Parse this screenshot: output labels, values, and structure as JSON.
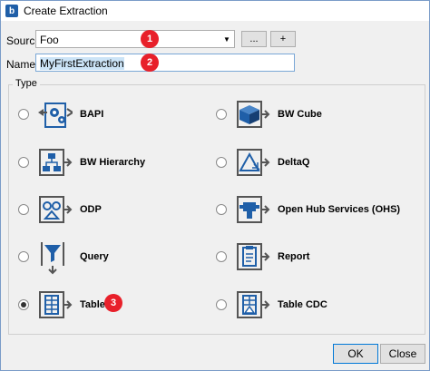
{
  "window": {
    "title": "Create Extraction",
    "app_icon": "b"
  },
  "form": {
    "source_label": "Source",
    "source_value": "Foo",
    "browse_label": "...",
    "add_label": "+",
    "name_label": "Name",
    "name_value": "MyFirstExtraction"
  },
  "badges": [
    "1",
    "2",
    "3"
  ],
  "type_group": {
    "title": "Type",
    "options": [
      {
        "label": "BAPI",
        "icon": "bapi-gears-icon",
        "checked": false
      },
      {
        "label": "BW Cube",
        "icon": "bw-cube-icon",
        "checked": false
      },
      {
        "label": "BW Hierarchy",
        "icon": "bw-hierarchy-icon",
        "checked": false
      },
      {
        "label": "DeltaQ",
        "icon": "deltaq-icon",
        "checked": false
      },
      {
        "label": "ODP",
        "icon": "odp-icon",
        "checked": false
      },
      {
        "label": "Open Hub Services (OHS)",
        "icon": "open-hub-icon",
        "checked": false
      },
      {
        "label": "Query",
        "icon": "query-filter-icon",
        "checked": false
      },
      {
        "label": "Report",
        "icon": "report-icon",
        "checked": false
      },
      {
        "label": "Table",
        "icon": "table-icon",
        "checked": true
      },
      {
        "label": "Table CDC",
        "icon": "table-cdc-icon",
        "checked": false
      }
    ]
  },
  "footer": {
    "ok_label": "OK",
    "close_label": "Close"
  },
  "colors": {
    "icon_blue": "#1f5fa8",
    "badge_red": "#e8202a"
  }
}
